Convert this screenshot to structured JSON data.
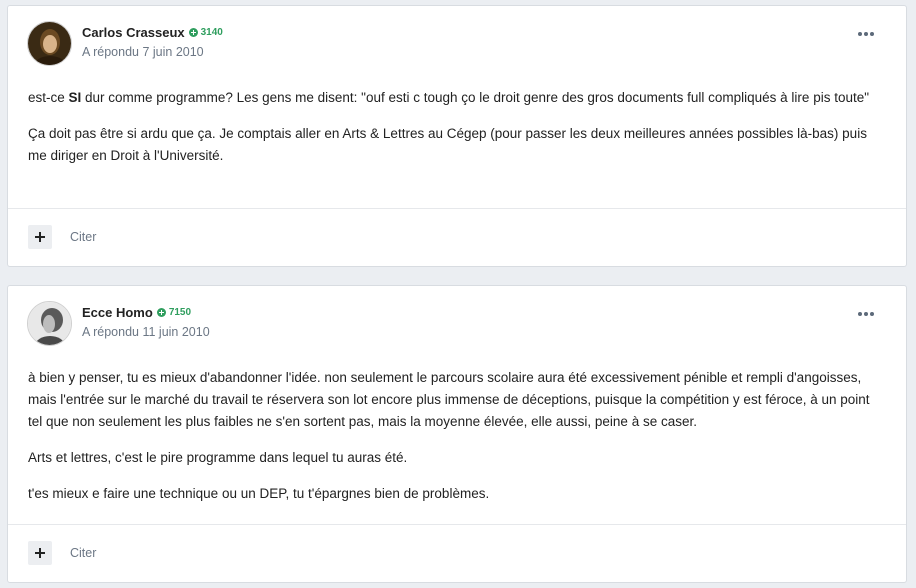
{
  "posts": [
    {
      "author": "Carlos Crasseux",
      "reputation": "3140",
      "timestamp": "A répondu 7 juin 2010",
      "paragraphs": [
        {
          "before": "est-ce ",
          "bold": "SI",
          "after": " dur comme programme? Les gens me disent: \"ouf esti c tough ço le droit genre des gros documents full compliqués à lire pis toute\""
        },
        {
          "text": "Ça doit pas être si ardu que ça. Je comptais aller en Arts & Lettres au Cégep (pour passer les deux meilleures années possibles là-bas) puis me diriger en Droit à l'Université."
        }
      ],
      "quote_label": "Citer"
    },
    {
      "author": "Ecce Homo",
      "reputation": "7150",
      "timestamp": "A répondu 11 juin 2010",
      "paragraphs": [
        {
          "text": "à bien y penser, tu es mieux d'abandonner l'idée. non seulement le parcours scolaire aura été excessivement pénible et rempli d'angoisses, mais l'entrée sur le marché du travail te réservera son lot encore plus immense de déceptions, puisque la compétition y est féroce, à un point tel que non seulement les plus faibles ne s'en sortent pas, mais la moyenne élevée, elle aussi, peine à se caser."
        },
        {
          "text": "Arts et lettres, c'est le pire programme dans lequel tu auras été."
        },
        {
          "text": "t'es mieux e faire une technique ou un DEP, tu t'épargnes bien de problèmes."
        }
      ],
      "quote_label": "Citer"
    }
  ],
  "colors": {
    "reputation": "#2f9e5e",
    "meta_text": "#6c7785",
    "page_background": "#ebeef2"
  }
}
